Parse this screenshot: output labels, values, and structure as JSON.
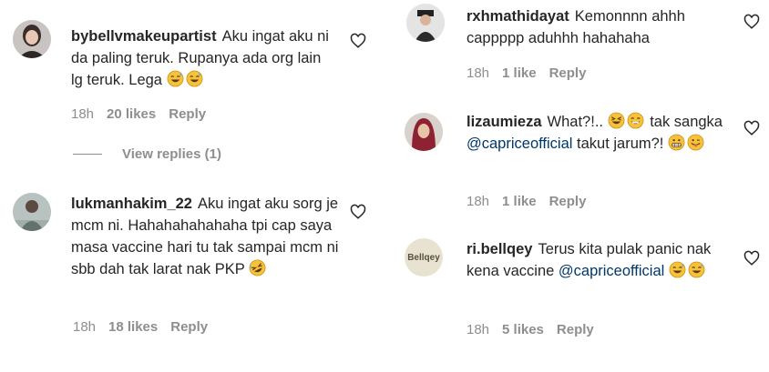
{
  "left_column": {
    "comments": [
      {
        "username": "bybellvmakeupartist",
        "text": "Aku ingat aku ni da paling teruk. Rupanya ada org lain lg teruk. Lega",
        "emojis": [
          "grinning-sweat-emoji",
          "grinning-sweat-emoji"
        ],
        "time": "18h",
        "likes": "20 likes",
        "reply_label": "Reply",
        "view_replies": "View replies (1)"
      },
      {
        "username": "lukmanhakim_22",
        "text": "Aku ingat aku sorg je mcm ni. Hahahahahahaha tpi cap saya masa vaccine hari tu tak sampai mcm ni sbb dah tak larat nak PKP",
        "emojis": [
          "rolling-laughing-emoji"
        ],
        "time": "18h",
        "likes": "18 likes",
        "reply_label": "Reply"
      }
    ]
  },
  "right_column": {
    "comments": [
      {
        "username": "rxhmathidayat",
        "text": "Kemonnnn ahhh cappppp aduhhh hahahaha",
        "time": "18h",
        "likes": "1 like",
        "reply_label": "Reply"
      },
      {
        "username": "lizaumieza",
        "text_before": "What?!..",
        "text_middle": "tak sangka",
        "mention": "@capriceofficial",
        "text_after": "takut jarum?!",
        "emojis_1": [
          "grinning-squint-emoji",
          "grinning-emoji"
        ],
        "emojis_2": [
          "grimacing-emoji",
          "tongue-emoji"
        ],
        "time": "18h",
        "likes": "1 like",
        "reply_label": "Reply"
      },
      {
        "username": "ri.bellqey",
        "avatar_text": "Bellqey",
        "text": "Terus kita pulak panic nak kena vaccine",
        "mention": "@capriceofficial",
        "emojis": [
          "grinning-sweat-emoji",
          "grinning-sweat-emoji"
        ],
        "time": "18h",
        "likes": "5 likes",
        "reply_label": "Reply"
      }
    ]
  },
  "colors": {
    "text": "#262626",
    "secondary": "#8e8e8e",
    "mention": "#00376b",
    "emoji_yellow": "#f7c23a"
  }
}
